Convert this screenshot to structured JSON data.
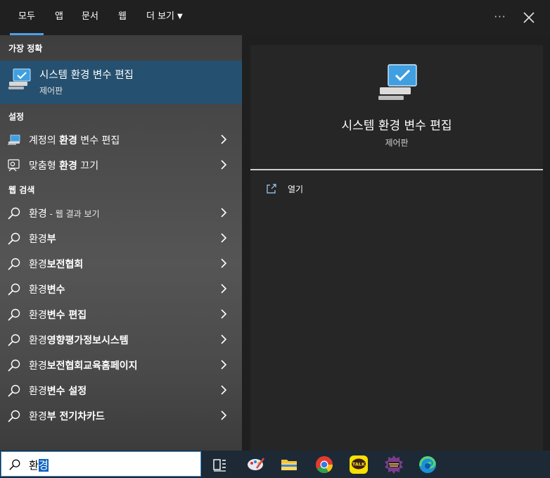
{
  "tabs": [
    {
      "label": "모두",
      "active": true
    },
    {
      "label": "앱"
    },
    {
      "label": "문서"
    },
    {
      "label": "웹"
    },
    {
      "label": "더 보기"
    }
  ],
  "window_controls": {
    "more": "···",
    "close": "✕"
  },
  "best_match": {
    "heading": "가장 정확",
    "title": "시스템 환경 변수 편집",
    "subtitle": "제어판",
    "icon": "monitor-check-icon"
  },
  "settings": {
    "heading": "설정",
    "items": [
      {
        "prefix": "계정의 ",
        "bold": "환경",
        "suffix": " 변수 편집",
        "icon": "laptop-icon"
      },
      {
        "prefix": "맞춤형 ",
        "bold": "환경",
        "suffix": " 끄기",
        "icon": "person-feedback-icon"
      }
    ]
  },
  "web": {
    "heading": "웹 검색",
    "items": [
      {
        "prefix": "환경",
        "bold": "",
        "suffix": " - 웹 결과 보기",
        "icon": "search-icon"
      },
      {
        "prefix": "환경",
        "bold": "부",
        "suffix": "",
        "icon": "search-icon"
      },
      {
        "prefix": "환경",
        "bold": "보전협회",
        "suffix": "",
        "icon": "search-icon"
      },
      {
        "prefix": "환경",
        "bold": "변수",
        "suffix": "",
        "icon": "search-icon"
      },
      {
        "prefix": "환경",
        "bold": "변수 편집",
        "suffix": "",
        "icon": "search-icon"
      },
      {
        "prefix": "환경",
        "bold": "영향평가정보시스템",
        "suffix": "",
        "icon": "search-icon"
      },
      {
        "prefix": "환경",
        "bold": "보전협회교육홈페이지",
        "suffix": "",
        "icon": "search-icon"
      },
      {
        "prefix": "환경",
        "bold": "변수 설정",
        "suffix": "",
        "icon": "search-icon"
      },
      {
        "prefix": "환경",
        "bold": "부 전기차카드",
        "suffix": "",
        "icon": "search-icon"
      }
    ]
  },
  "preview": {
    "title": "시스템 환경 변수 편집",
    "subtitle": "제어판",
    "action_label": "열기",
    "action_icon": "open-external-icon"
  },
  "taskbar": {
    "search_value_plain": "환",
    "search_value_selected": "경",
    "icons": [
      "task-view-icon",
      "paint-icon",
      "file-explorer-icon",
      "chrome-icon",
      "kakaotalk-icon",
      "game-app-icon",
      "edge-icon"
    ],
    "kakao_label": "TALK"
  },
  "colors": {
    "accent": "#4ea0e8",
    "best_match_bg": "#26506f",
    "taskbar_bg": "#1d2a35",
    "selection": "#0b64c0"
  }
}
